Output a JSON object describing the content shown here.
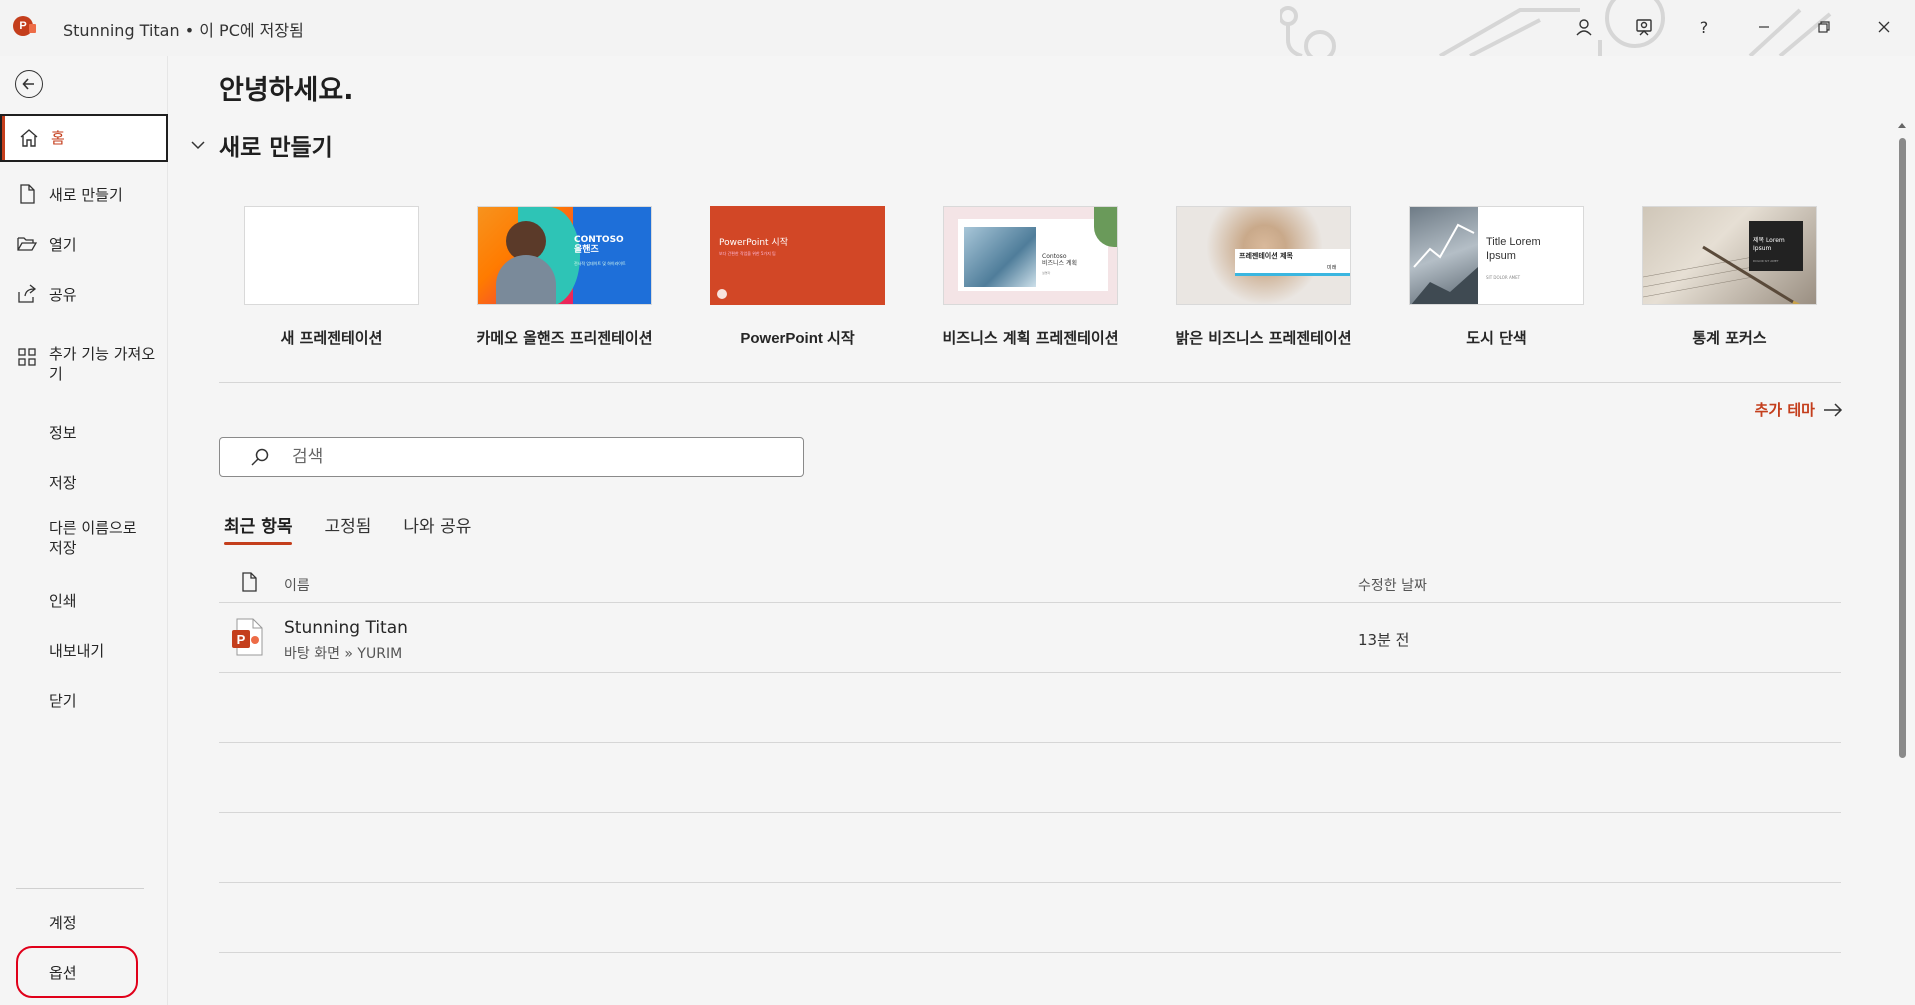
{
  "titlebar": {
    "doc_title": "Stunning Titan • 이 PC에 저장됨",
    "help_label": "?"
  },
  "sidebar": {
    "items": [
      {
        "label": "홈"
      },
      {
        "label": "새로 만들기"
      },
      {
        "label": "열기"
      },
      {
        "label": "공유"
      },
      {
        "label": "추가 기능 가져오기"
      },
      {
        "label": "정보"
      },
      {
        "label": "저장"
      },
      {
        "label": "다른 이름으로 저장"
      },
      {
        "label": "인쇄"
      },
      {
        "label": "내보내기"
      },
      {
        "label": "닫기"
      },
      {
        "label": "계정"
      },
      {
        "label": "옵션"
      }
    ]
  },
  "main": {
    "greeting": "안녕하세요.",
    "new_section": "새로 만들기",
    "templates": [
      {
        "name": "새 프레젠테이션"
      },
      {
        "name": "카메오 올핸즈 프리젠테이션",
        "thumb_title": "CONTOSO\n올핸즈",
        "thumb_sub": "전사적 업데이트 및 하이라이트"
      },
      {
        "name": "PowerPoint 시작",
        "thumb_title": "PowerPoint 시작",
        "thumb_sub": "보다 간편한 작업을 위한 5가지 팁"
      },
      {
        "name": "비즈니스 계획 프레젠테이션",
        "thumb_title": "Contoso\n비즈니스 계획",
        "thumb_sub": "설명자"
      },
      {
        "name": "밝은 비즈니스 프레젠테이션",
        "thumb_title": "프레젠테이션 제목",
        "thumb_sub": "미래"
      },
      {
        "name": "도시 단색",
        "thumb_title": "Title Lorem\nIpsum",
        "thumb_sub": "SIT DOLOR AMET"
      },
      {
        "name": "통계 포커스",
        "thumb_title": "제목 Lorem\nIpsum",
        "thumb_sub": "DOLOR SIT AMET"
      }
    ],
    "more_themes": "추가 테마",
    "search_placeholder": "검색",
    "tabs": [
      {
        "label": "최근 항목"
      },
      {
        "label": "고정됨"
      },
      {
        "label": "나와 공유"
      }
    ],
    "list": {
      "col_name": "이름",
      "col_date": "수정한 날짜",
      "rows": [
        {
          "name": "Stunning Titan",
          "path": "바탕 화면 » YURIM",
          "date": "13분 전"
        }
      ]
    }
  },
  "colors": {
    "accent": "#c43e1c",
    "highlight": "#e0001a"
  }
}
